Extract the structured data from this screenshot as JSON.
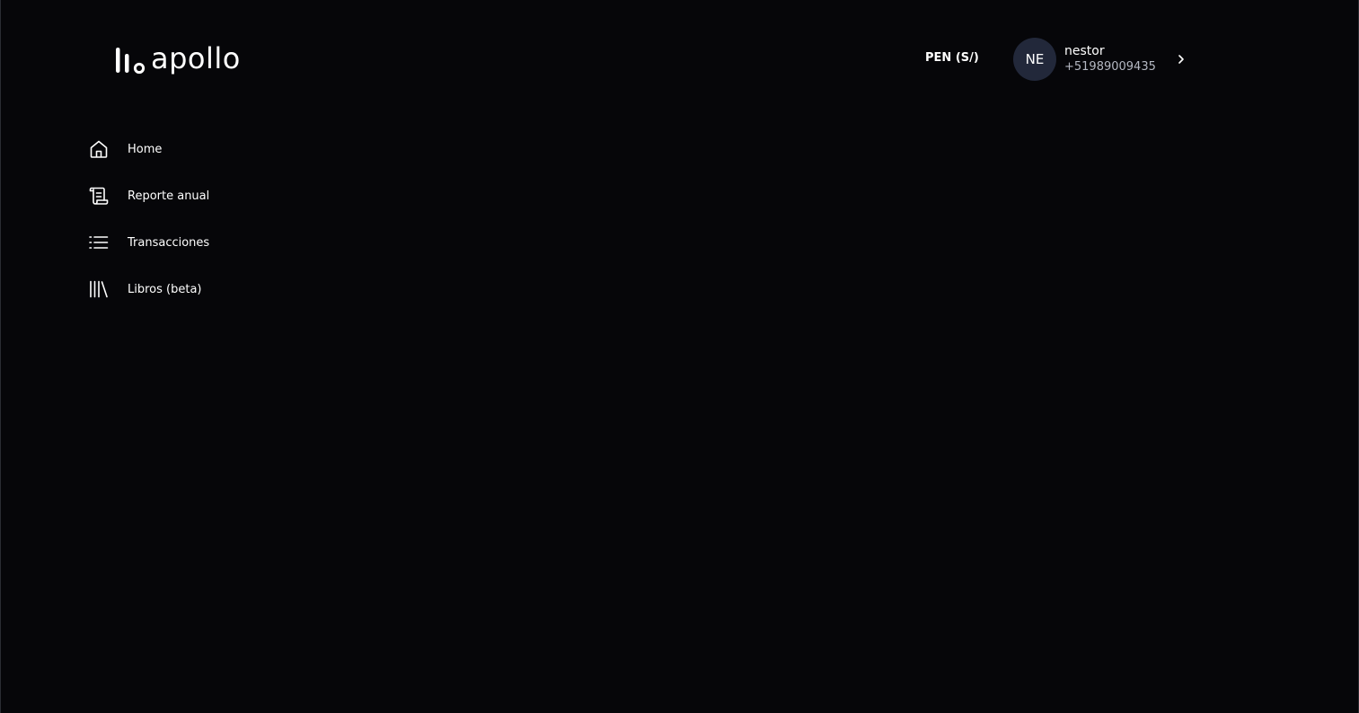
{
  "brand": {
    "name": "apollo"
  },
  "header": {
    "currency": "PEN (S/)",
    "user": {
      "initials": "NE",
      "name": "nestor",
      "phone": "+51989009435"
    }
  },
  "sidebar": {
    "items": [
      {
        "label": "Home",
        "icon": "home-icon"
      },
      {
        "label": "Reporte anual",
        "icon": "scroll-icon"
      },
      {
        "label": "Transacciones",
        "icon": "list-icon"
      },
      {
        "label": "Libros (beta)",
        "icon": "library-icon"
      }
    ]
  },
  "colors": {
    "background": "#060609",
    "avatar": "#22283a",
    "text": "#ffffff",
    "muted_text": "#b4b8c2"
  }
}
